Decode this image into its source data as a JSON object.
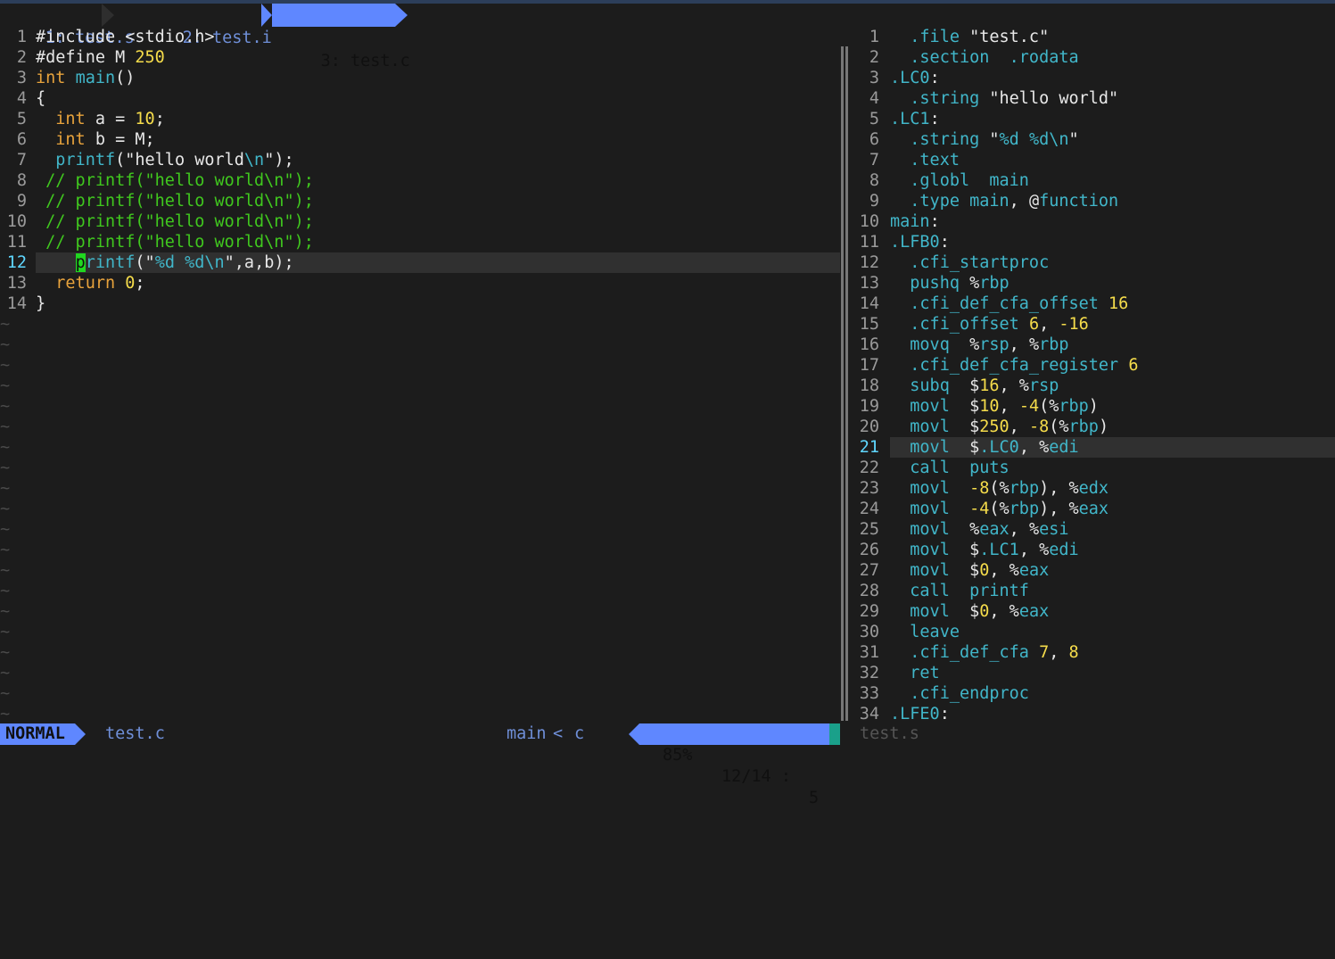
{
  "tabs": [
    {
      "label": "1: test.s"
    },
    {
      "label": "2: test.i"
    },
    {
      "label": "3: test.c",
      "active": true
    }
  ],
  "left_pane": {
    "file": "test.c",
    "current_line": 12,
    "lines": [
      {
        "n": "1",
        "tokens": [
          [
            "pp",
            "#include "
          ],
          [
            "str",
            "<stdio.h>"
          ]
        ]
      },
      {
        "n": "2",
        "tokens": [
          [
            "pp",
            "#define "
          ],
          [
            "pp",
            "M "
          ],
          [
            "num",
            "250"
          ]
        ]
      },
      {
        "n": "3",
        "tokens": [
          [
            "kw",
            "int "
          ],
          [
            "fn",
            "main"
          ],
          [
            "pp",
            "()"
          ]
        ]
      },
      {
        "n": "4",
        "tokens": [
          [
            "pp",
            "{"
          ]
        ]
      },
      {
        "n": "5",
        "tokens": [
          [
            "pp",
            "  "
          ],
          [
            "kw",
            "int"
          ],
          [
            "pp",
            " a = "
          ],
          [
            "num",
            "10"
          ],
          [
            "pp",
            ";"
          ]
        ]
      },
      {
        "n": "6",
        "tokens": [
          [
            "pp",
            "  "
          ],
          [
            "kw",
            "int"
          ],
          [
            "pp",
            " b = M;"
          ]
        ]
      },
      {
        "n": "7",
        "tokens": [
          [
            "pp",
            "  "
          ],
          [
            "fn",
            "printf"
          ],
          [
            "pp",
            "(\""
          ],
          [
            "str",
            "hello world"
          ],
          [
            "esc",
            "\\n"
          ],
          [
            "pp",
            "\");"
          ]
        ]
      },
      {
        "n": "8",
        "tokens": [
          [
            "cm",
            " // printf(\"hello world\\n\");"
          ]
        ]
      },
      {
        "n": "9",
        "tokens": [
          [
            "cm",
            " // printf(\"hello world\\n\");"
          ]
        ]
      },
      {
        "n": "10",
        "tokens": [
          [
            "cm",
            " // printf(\"hello world\\n\");"
          ]
        ]
      },
      {
        "n": "11",
        "tokens": [
          [
            "cm",
            " // printf(\"hello world\\n\");"
          ]
        ]
      },
      {
        "n": "12",
        "tokens": [
          [
            "pp",
            "    "
          ],
          [
            "cursor",
            "p"
          ],
          [
            "fn",
            "rintf"
          ],
          [
            "pp",
            "(\""
          ],
          [
            "esc",
            "%d %d\\n"
          ],
          [
            "pp",
            "\",a,b);"
          ]
        ]
      },
      {
        "n": "13",
        "tokens": [
          [
            "pp",
            "  "
          ],
          [
            "kw",
            "return "
          ],
          [
            "num",
            "0"
          ],
          [
            "pp",
            ";"
          ]
        ]
      },
      {
        "n": "14",
        "tokens": [
          [
            "pp",
            "}"
          ]
        ]
      }
    ],
    "tilde_rows": 20,
    "tilde": "~"
  },
  "right_pane": {
    "file": "test.s",
    "current_line": 21,
    "lines": [
      {
        "n": "1",
        "tokens": [
          [
            "pp",
            "  "
          ],
          [
            "dir",
            ".file "
          ],
          [
            "str",
            "\"test.c\""
          ]
        ]
      },
      {
        "n": "2",
        "tokens": [
          [
            "pp",
            "  "
          ],
          [
            "dir",
            ".section  .rodata"
          ]
        ]
      },
      {
        "n": "3",
        "tokens": [
          [
            "lbl",
            ".LC0"
          ],
          [
            "pp",
            ":"
          ]
        ]
      },
      {
        "n": "4",
        "tokens": [
          [
            "pp",
            "  "
          ],
          [
            "dir",
            ".string "
          ],
          [
            "str",
            "\"hello world\""
          ]
        ]
      },
      {
        "n": "5",
        "tokens": [
          [
            "lbl",
            ".LC1"
          ],
          [
            "pp",
            ":"
          ]
        ]
      },
      {
        "n": "6",
        "tokens": [
          [
            "pp",
            "  "
          ],
          [
            "dir",
            ".string "
          ],
          [
            "str",
            "\""
          ],
          [
            "esc",
            "%d %d\\n"
          ],
          [
            "str",
            "\""
          ]
        ]
      },
      {
        "n": "7",
        "tokens": [
          [
            "pp",
            "  "
          ],
          [
            "dir",
            ".text"
          ]
        ]
      },
      {
        "n": "8",
        "tokens": [
          [
            "pp",
            "  "
          ],
          [
            "dir",
            ".globl  main"
          ]
        ]
      },
      {
        "n": "9",
        "tokens": [
          [
            "pp",
            "  "
          ],
          [
            "dir",
            ".type main"
          ],
          [
            "pp",
            ", @"
          ],
          [
            "fn",
            "function"
          ]
        ]
      },
      {
        "n": "10",
        "tokens": [
          [
            "lbl",
            "main"
          ],
          [
            "pp",
            ":"
          ]
        ]
      },
      {
        "n": "11",
        "tokens": [
          [
            "lbl",
            ".LFB0"
          ],
          [
            "pp",
            ":"
          ]
        ]
      },
      {
        "n": "12",
        "tokens": [
          [
            "pp",
            "  "
          ],
          [
            "dir",
            ".cfi_startproc"
          ]
        ]
      },
      {
        "n": "13",
        "tokens": [
          [
            "pp",
            "  "
          ],
          [
            "fn",
            "pushq "
          ],
          [
            "pp",
            "%"
          ],
          [
            "reg",
            "rbp"
          ]
        ]
      },
      {
        "n": "14",
        "tokens": [
          [
            "pp",
            "  "
          ],
          [
            "dir",
            ".cfi_def_cfa_offset "
          ],
          [
            "num",
            "16"
          ]
        ]
      },
      {
        "n": "15",
        "tokens": [
          [
            "pp",
            "  "
          ],
          [
            "dir",
            ".cfi_offset "
          ],
          [
            "num",
            "6"
          ],
          [
            "pp",
            ", "
          ],
          [
            "num",
            "-16"
          ]
        ]
      },
      {
        "n": "16",
        "tokens": [
          [
            "pp",
            "  "
          ],
          [
            "fn",
            "movq  "
          ],
          [
            "pp",
            "%"
          ],
          [
            "reg",
            "rsp"
          ],
          [
            "pp",
            ", %"
          ],
          [
            "reg",
            "rbp"
          ]
        ]
      },
      {
        "n": "17",
        "tokens": [
          [
            "pp",
            "  "
          ],
          [
            "dir",
            ".cfi_def_cfa_register "
          ],
          [
            "num",
            "6"
          ]
        ]
      },
      {
        "n": "18",
        "tokens": [
          [
            "pp",
            "  "
          ],
          [
            "fn",
            "subq  "
          ],
          [
            "pp",
            "$"
          ],
          [
            "num",
            "16"
          ],
          [
            "pp",
            ", %"
          ],
          [
            "reg",
            "rsp"
          ]
        ]
      },
      {
        "n": "19",
        "tokens": [
          [
            "pp",
            "  "
          ],
          [
            "fn",
            "movl  "
          ],
          [
            "pp",
            "$"
          ],
          [
            "num",
            "10"
          ],
          [
            "pp",
            ", "
          ],
          [
            "num",
            "-4"
          ],
          [
            "pp",
            "(%"
          ],
          [
            "reg",
            "rbp"
          ],
          [
            "pp",
            ")"
          ]
        ]
      },
      {
        "n": "20",
        "tokens": [
          [
            "pp",
            "  "
          ],
          [
            "fn",
            "movl  "
          ],
          [
            "pp",
            "$"
          ],
          [
            "num",
            "250"
          ],
          [
            "pp",
            ", "
          ],
          [
            "num",
            "-8"
          ],
          [
            "pp",
            "(%"
          ],
          [
            "reg",
            "rbp"
          ],
          [
            "pp",
            ")"
          ]
        ]
      },
      {
        "n": "21",
        "tokens": [
          [
            "pp",
            "  "
          ],
          [
            "fn",
            "movl  "
          ],
          [
            "pp",
            "$"
          ],
          [
            "lbl",
            ".LC0"
          ],
          [
            "pp",
            ", %"
          ],
          [
            "reg",
            "edi"
          ]
        ]
      },
      {
        "n": "22",
        "tokens": [
          [
            "pp",
            "  "
          ],
          [
            "fn",
            "call  puts"
          ]
        ]
      },
      {
        "n": "23",
        "tokens": [
          [
            "pp",
            "  "
          ],
          [
            "fn",
            "movl  "
          ],
          [
            "num",
            "-8"
          ],
          [
            "pp",
            "(%"
          ],
          [
            "reg",
            "rbp"
          ],
          [
            "pp",
            "), %"
          ],
          [
            "reg",
            "edx"
          ]
        ]
      },
      {
        "n": "24",
        "tokens": [
          [
            "pp",
            "  "
          ],
          [
            "fn",
            "movl  "
          ],
          [
            "num",
            "-4"
          ],
          [
            "pp",
            "(%"
          ],
          [
            "reg",
            "rbp"
          ],
          [
            "pp",
            "), %"
          ],
          [
            "reg",
            "eax"
          ]
        ]
      },
      {
        "n": "25",
        "tokens": [
          [
            "pp",
            "  "
          ],
          [
            "fn",
            "movl  "
          ],
          [
            "pp",
            "%"
          ],
          [
            "reg",
            "eax"
          ],
          [
            "pp",
            ", %"
          ],
          [
            "reg",
            "esi"
          ]
        ]
      },
      {
        "n": "26",
        "tokens": [
          [
            "pp",
            "  "
          ],
          [
            "fn",
            "movl  "
          ],
          [
            "pp",
            "$"
          ],
          [
            "lbl",
            ".LC1"
          ],
          [
            "pp",
            ", %"
          ],
          [
            "reg",
            "edi"
          ]
        ]
      },
      {
        "n": "27",
        "tokens": [
          [
            "pp",
            "  "
          ],
          [
            "fn",
            "movl  "
          ],
          [
            "pp",
            "$"
          ],
          [
            "num",
            "0"
          ],
          [
            "pp",
            ", %"
          ],
          [
            "reg",
            "eax"
          ]
        ]
      },
      {
        "n": "28",
        "tokens": [
          [
            "pp",
            "  "
          ],
          [
            "fn",
            "call  printf"
          ]
        ]
      },
      {
        "n": "29",
        "tokens": [
          [
            "pp",
            "  "
          ],
          [
            "fn",
            "movl  "
          ],
          [
            "pp",
            "$"
          ],
          [
            "num",
            "0"
          ],
          [
            "pp",
            ", %"
          ],
          [
            "reg",
            "eax"
          ]
        ]
      },
      {
        "n": "30",
        "tokens": [
          [
            "pp",
            "  "
          ],
          [
            "fn",
            "leave"
          ]
        ]
      },
      {
        "n": "31",
        "tokens": [
          [
            "pp",
            "  "
          ],
          [
            "dir",
            ".cfi_def_cfa "
          ],
          [
            "num",
            "7"
          ],
          [
            "pp",
            ", "
          ],
          [
            "num",
            "8"
          ]
        ]
      },
      {
        "n": "32",
        "tokens": [
          [
            "pp",
            "  "
          ],
          [
            "fn",
            "ret"
          ]
        ]
      },
      {
        "n": "33",
        "tokens": [
          [
            "pp",
            "  "
          ],
          [
            "dir",
            ".cfi_endproc"
          ]
        ]
      },
      {
        "n": "34",
        "tokens": [
          [
            "lbl",
            ".LFE0"
          ],
          [
            "pp",
            ":"
          ]
        ]
      }
    ]
  },
  "statusline": {
    "mode": "NORMAL",
    "file": "test.c",
    "function": "main",
    "separator": "<",
    "filetype": "c",
    "percent": "85%",
    "line_col": "12/14 :",
    "col": "5",
    "right_file": "test.s"
  },
  "colors": {
    "background": "#1c1c1c",
    "accent": "#5f87ff",
    "comment": "#40c81e",
    "keyword": "#e8a33c",
    "number": "#f5dc4b",
    "identifier": "#41b6c9"
  }
}
